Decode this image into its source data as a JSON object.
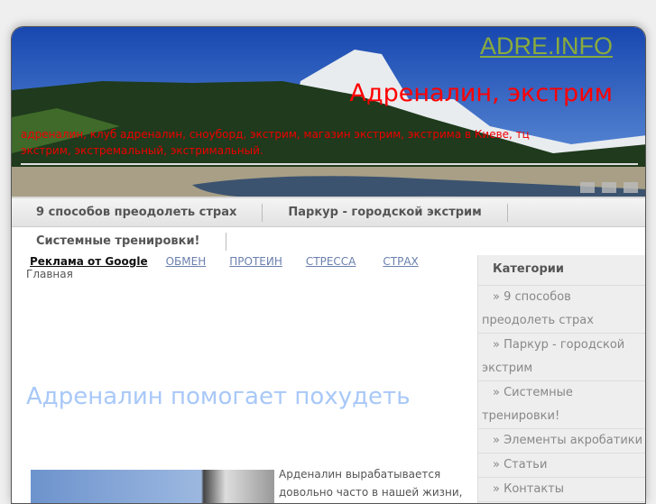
{
  "header": {
    "site_name": "ADRE.INFO",
    "slogan": "Адреналин, экстрим",
    "keywords": "адреналин, клуб адреналин, сноуборд, экстрим, магазин экстрим, экстрима в Киеве, тц экстрим, экстремальный, экстримальный."
  },
  "nav": {
    "row1": [
      "9 способов преодолеть страх",
      "Паркур - городской экстрим"
    ],
    "row2": [
      "Системные тренировки!"
    ]
  },
  "ads": {
    "label": "Реклама от Google",
    "links": [
      "ОБМЕН",
      "ПРОТЕИН",
      "СТРЕССА",
      "СТРАХ"
    ]
  },
  "breadcrumb": "Главная",
  "article": {
    "title": "Адреналин помогает похудеть",
    "text": "Арденалин вырабатывается довольно часто в нашей жизни, а"
  },
  "sidebar": {
    "title": "Категории",
    "items": [
      {
        "prefix": "» ",
        "first": "9 способов",
        "rest": "преодолеть страх"
      },
      {
        "prefix": "» ",
        "first": "Паркур - городской",
        "rest": "экстрим"
      },
      {
        "prefix": "» ",
        "first": "Системные",
        "rest": "тренировки!"
      },
      {
        "prefix": "» ",
        "first": "Элементы акробатики",
        "rest": ""
      },
      {
        "prefix": "» ",
        "first": "Статьи",
        "rest": ""
      },
      {
        "prefix": "» ",
        "first": "Контакты",
        "rest": ""
      }
    ]
  }
}
